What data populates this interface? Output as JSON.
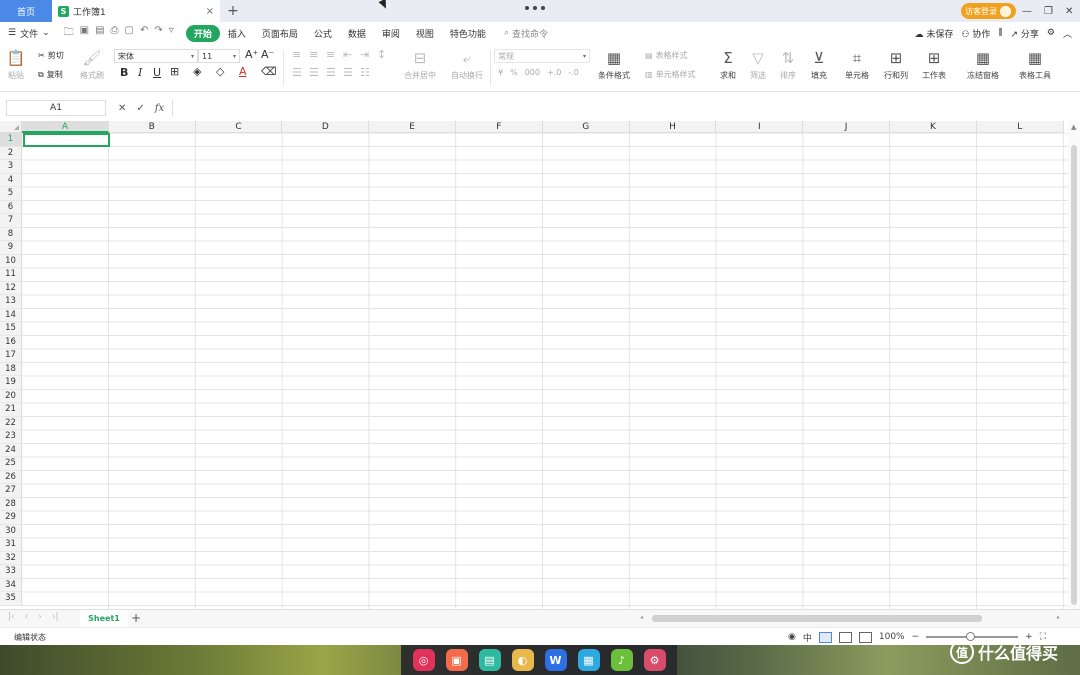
{
  "titlebar": {
    "home_tab": "首页",
    "doc_badge": "S",
    "doc_tab": "工作簿1",
    "new_tab": "+",
    "login": "访客登录"
  },
  "menubar": {
    "file": "文件",
    "tabs": [
      "开始",
      "插入",
      "页面布局",
      "公式",
      "数据",
      "审阅",
      "视图",
      "特色功能"
    ],
    "active_tab": "开始",
    "search": "查找命令",
    "unsaved": "未保存",
    "collab": "协作",
    "share": "分享"
  },
  "ribbon": {
    "paste": "粘贴",
    "cut": "剪切",
    "copy": "复制",
    "format_painter": "格式刷",
    "font_name": "宋体",
    "font_size": "11",
    "bold": "B",
    "italic": "I",
    "underline": "U",
    "merge_center": "合并居中",
    "wrap_text": "自动换行",
    "number_format": "常规",
    "conditional_format": "条件格式",
    "table_style": "表格样式",
    "cell_style": "单元格样式",
    "sum": "求和",
    "filter": "筛选",
    "sort": "排序",
    "fill": "填充",
    "cell": "单元格",
    "row_col": "行和列",
    "worksheet": "工作表",
    "freeze": "冻结窗格",
    "table_tools": "表格工具"
  },
  "formula_bar": {
    "name_box": "A1",
    "fx": "fx",
    "value": ""
  },
  "grid": {
    "columns": [
      "A",
      "B",
      "C",
      "D",
      "E",
      "F",
      "G",
      "H",
      "I",
      "J",
      "K",
      "L"
    ],
    "rows": [
      "1",
      "2",
      "3",
      "4",
      "5",
      "6",
      "7",
      "8",
      "9",
      "10",
      "11",
      "12",
      "13",
      "14",
      "15",
      "16",
      "17",
      "18",
      "19",
      "20",
      "21",
      "22",
      "23",
      "24",
      "25",
      "26",
      "27",
      "28",
      "29",
      "30",
      "31",
      "32",
      "33",
      "34",
      "35"
    ],
    "active_cell": "A1"
  },
  "sheets": {
    "tabs": [
      "Sheet1"
    ],
    "active": "Sheet1",
    "add": "+"
  },
  "statusbar": {
    "mode": "编辑状态",
    "zoom": "100%",
    "zoom_out": "−",
    "zoom_in": "+"
  },
  "watermark": {
    "text": "什么值得买",
    "logo": "值"
  },
  "colors": {
    "accent_green": "#22a660",
    "home_tab_blue": "#4b89e6",
    "login_orange": "#f0a21e"
  }
}
